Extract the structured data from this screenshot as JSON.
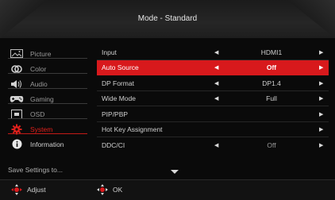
{
  "header": {
    "title": "Mode - Standard"
  },
  "sidebar": {
    "items": [
      {
        "label": "Picture",
        "icon": "picture-icon"
      },
      {
        "label": "Color",
        "icon": "color-icon"
      },
      {
        "label": "Audio",
        "icon": "speaker-icon"
      },
      {
        "label": "Gaming",
        "icon": "gamepad-icon"
      },
      {
        "label": "OSD",
        "icon": "osd-icon"
      },
      {
        "label": "System",
        "icon": "gear-icon"
      },
      {
        "label": "Information",
        "icon": "info-icon"
      }
    ],
    "save_label": "Save Settings to..."
  },
  "settings": {
    "rows": [
      {
        "label": "Input",
        "value": "HDMI1",
        "left_arrow": true,
        "right_arrow": true
      },
      {
        "label": "Auto Source",
        "value": "Off",
        "left_arrow": true,
        "right_arrow": true
      },
      {
        "label": "DP Format",
        "value": "DP1.4",
        "left_arrow": true,
        "right_arrow": true
      },
      {
        "label": "Wide Mode",
        "value": "Full",
        "left_arrow": true,
        "right_arrow": true
      },
      {
        "label": "PIP/PBP",
        "value": "",
        "left_arrow": false,
        "right_arrow": true
      },
      {
        "label": "Hot Key Assignment",
        "value": "",
        "left_arrow": false,
        "right_arrow": true
      },
      {
        "label": "DDC/CI",
        "value": "Off",
        "left_arrow": true,
        "right_arrow": true
      }
    ]
  },
  "footer": {
    "adjust_label": "Adjust",
    "ok_label": "OK"
  },
  "colors": {
    "accent": "#d8191c",
    "background": "#0a0a0a",
    "text": "#cfcfcf"
  }
}
